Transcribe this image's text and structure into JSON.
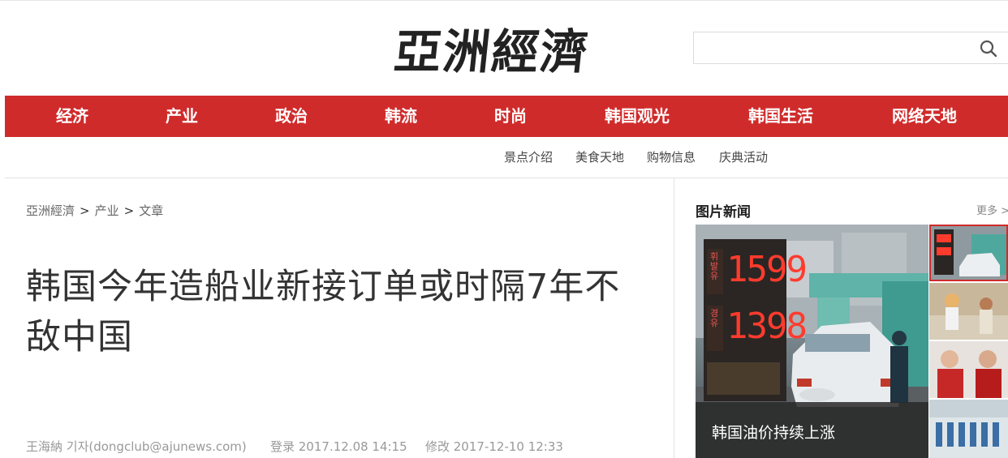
{
  "logo": {
    "text": "亞洲經濟"
  },
  "search": {
    "placeholder": "",
    "value": ""
  },
  "nav": {
    "items": [
      {
        "label": "经济"
      },
      {
        "label": "产业"
      },
      {
        "label": "政治"
      },
      {
        "label": "韩流"
      },
      {
        "label": "时尚"
      },
      {
        "label": "韩国观光"
      },
      {
        "label": "韩国生活"
      },
      {
        "label": "网络天地"
      }
    ],
    "active_color": "#d02b2b"
  },
  "subnav": {
    "items": [
      {
        "label": "景点介绍"
      },
      {
        "label": "美食天地"
      },
      {
        "label": "购物信息"
      },
      {
        "label": "庆典活动"
      }
    ]
  },
  "breadcrumb": {
    "home": "亞洲經濟",
    "section": "产业",
    "page": "文章",
    "separator": ">"
  },
  "article": {
    "title": "韩国今年造船业新接订单或时隔7年不敌中国",
    "author": "王海納 기자(dongclub@ajunews.com)",
    "published": "登录 2017.12.08 14:15",
    "modified": "修改 2017-12-10 12:33"
  },
  "sidebar": {
    "heading": "图片新闻",
    "more": "更多 >",
    "main_photo": {
      "caption": "韩国油价持续上涨",
      "sign_top": "1599",
      "sign_bottom": "1398",
      "sign_label_top": "휘발유",
      "sign_label_bottom": "경유"
    }
  }
}
